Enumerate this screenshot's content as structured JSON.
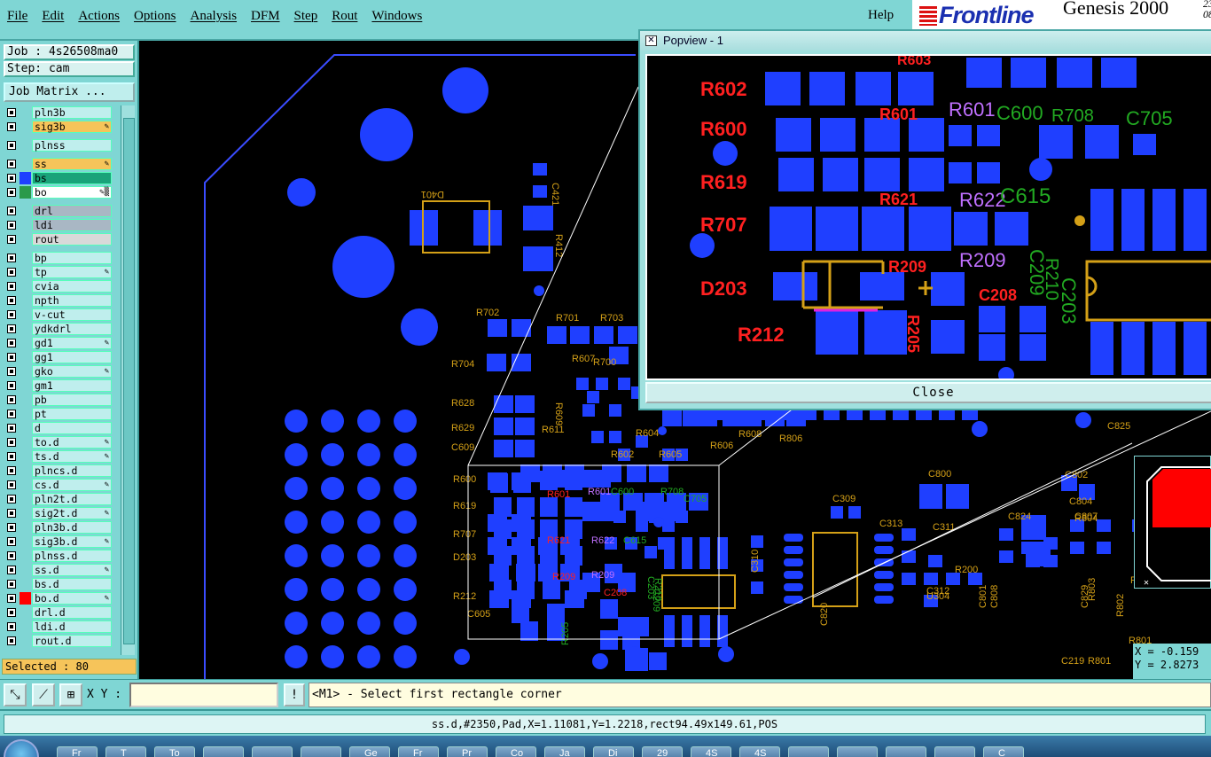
{
  "menu": {
    "items": [
      "File",
      "Edit",
      "Actions",
      "Options",
      "Analysis",
      "DFM",
      "Step",
      "Rout",
      "Windows"
    ],
    "help": "Help"
  },
  "brand": {
    "logo": "Frontline",
    "product": "Genesis 2000",
    "clock_top": "23",
    "clock_bottom": "08"
  },
  "job": {
    "job_line": "Job : 4s26508ma0",
    "step_line": "Step: cam",
    "job_matrix": "Job Matrix ..."
  },
  "layers": [
    {
      "name": "pln3b",
      "bg": "#bfeeed",
      "sq": "",
      "mark": ""
    },
    {
      "name": "sig3b",
      "bg": "#f6c45a",
      "sq": "",
      "mark": "✎"
    },
    {
      "name": "plnss",
      "bg": "#bfeeed",
      "sq": "",
      "mark": ""
    },
    {
      "name": "ss",
      "bg": "#f6c45a",
      "sq": "",
      "mark": "✎"
    },
    {
      "name": "bs",
      "bg": "#1aa37a",
      "sq": "#1f3fff",
      "mark": ""
    },
    {
      "name": "bo",
      "bg": "#ffffff",
      "sq": "#2a9a4a",
      "mark": "✎▒"
    },
    {
      "name": "drl",
      "bg": "#a9b7c4",
      "sq": "",
      "mark": ""
    },
    {
      "name": "ldi",
      "bg": "#a9b7c4",
      "sq": "",
      "mark": ""
    },
    {
      "name": "rout",
      "bg": "#d9d9d9",
      "sq": "",
      "mark": ""
    },
    {
      "name": "bp",
      "bg": "#bfeeed",
      "sq": "",
      "mark": ""
    },
    {
      "name": "tp",
      "bg": "#bfeeed",
      "sq": "",
      "mark": "✎"
    },
    {
      "name": "cvia",
      "bg": "#bfeeed",
      "sq": "",
      "mark": ""
    },
    {
      "name": "npth",
      "bg": "#bfeeed",
      "sq": "",
      "mark": ""
    },
    {
      "name": "v-cut",
      "bg": "#bfeeed",
      "sq": "",
      "mark": ""
    },
    {
      "name": "ydkdrl",
      "bg": "#bfeeed",
      "sq": "",
      "mark": ""
    },
    {
      "name": "gd1",
      "bg": "#bfeeed",
      "sq": "",
      "mark": "✎"
    },
    {
      "name": "gg1",
      "bg": "#bfeeed",
      "sq": "",
      "mark": ""
    },
    {
      "name": "gko",
      "bg": "#bfeeed",
      "sq": "",
      "mark": "✎"
    },
    {
      "name": "gm1",
      "bg": "#bfeeed",
      "sq": "",
      "mark": ""
    },
    {
      "name": "pb",
      "bg": "#bfeeed",
      "sq": "",
      "mark": ""
    },
    {
      "name": "pt",
      "bg": "#bfeeed",
      "sq": "",
      "mark": ""
    },
    {
      "name": "d",
      "bg": "#bfeeed",
      "sq": "",
      "mark": ""
    },
    {
      "name": "to.d",
      "bg": "#bfeeed",
      "sq": "",
      "mark": "✎"
    },
    {
      "name": "ts.d",
      "bg": "#bfeeed",
      "sq": "",
      "mark": "✎"
    },
    {
      "name": "plncs.d",
      "bg": "#bfeeed",
      "sq": "",
      "mark": ""
    },
    {
      "name": "cs.d",
      "bg": "#bfeeed",
      "sq": "",
      "mark": "✎"
    },
    {
      "name": "pln2t.d",
      "bg": "#bfeeed",
      "sq": "",
      "mark": ""
    },
    {
      "name": "sig2t.d",
      "bg": "#bfeeed",
      "sq": "",
      "mark": "✎"
    },
    {
      "name": "pln3b.d",
      "bg": "#bfeeed",
      "sq": "",
      "mark": ""
    },
    {
      "name": "sig3b.d",
      "bg": "#bfeeed",
      "sq": "",
      "mark": "✎"
    },
    {
      "name": "plnss.d",
      "bg": "#bfeeed",
      "sq": "",
      "mark": ""
    },
    {
      "name": "ss.d",
      "bg": "#bfeeed",
      "sq": "",
      "mark": "✎"
    },
    {
      "name": "bs.d",
      "bg": "#bfeeed",
      "sq": "",
      "mark": ""
    },
    {
      "name": "bo.d",
      "bg": "#bfeeed",
      "sq": "#ff0000",
      "mark": "✎"
    },
    {
      "name": "drl.d",
      "bg": "#bfeeed",
      "sq": "",
      "mark": ""
    },
    {
      "name": "ldi.d",
      "bg": "#bfeeed",
      "sq": "",
      "mark": ""
    },
    {
      "name": "rout.d",
      "bg": "#bfeeed",
      "sq": "",
      "mark": ""
    }
  ],
  "selected": "Selected : 80",
  "popview": {
    "title": "Popview - 1",
    "close": "Close",
    "labels_red": [
      "R602",
      "R600",
      "R619",
      "R707",
      "D203",
      "R212",
      "R601",
      "R621",
      "R209",
      "C208",
      "R603",
      "R205"
    ],
    "labels_purple": [
      "R601",
      "R622",
      "R209"
    ],
    "labels_green": [
      "C600",
      "R708",
      "C705",
      "C615",
      "R210",
      "C209",
      "C203"
    ]
  },
  "board": {
    "labels_orange": [
      "D401",
      "C421",
      "R412",
      "R702",
      "R701",
      "R703",
      "R700",
      "R704",
      "R607",
      "R628",
      "R629",
      "C609",
      "R609",
      "R611",
      "R604",
      "R605",
      "R602",
      "R600",
      "R619",
      "R707",
      "D203",
      "R212",
      "C605",
      "R606",
      "R608",
      "R806",
      "C800",
      "C802",
      "C804",
      "R804",
      "C807",
      "C311",
      "C309",
      "C313",
      "C310",
      "C312",
      "U304",
      "C820",
      "R200",
      "C219",
      "R801",
      "R801",
      "C829",
      "C808",
      "C801",
      "C824",
      "C825",
      "C808",
      "R802",
      "R800",
      "R803"
    ],
    "labels_red": [
      "R601",
      "R621",
      "R209",
      "C208"
    ],
    "labels_purple": [
      "R601",
      "R622",
      "R209"
    ],
    "labels_green": [
      "C600",
      "R708",
      "C705",
      "C615",
      "R210",
      "C209",
      "C203",
      "R205"
    ]
  },
  "coords": {
    "x": "X = -0.159",
    "y": "Y = 2.8273"
  },
  "toolbar": {
    "xy_label": "X Y :",
    "xy_value": "",
    "excl": "!",
    "prompt": "<M1> - Select first rectangle corner"
  },
  "status": "ss.d,#2350,Pad,X=1.11081,Y=1.2218,rect94.49x149.61,POS",
  "colors": {
    "pad": "#1f3fff",
    "silk_orange": "#d4a017",
    "silk_red": "#ff2020",
    "silk_green": "#22aa22",
    "silk_purple": "#c070ff",
    "outline": "#3a4cff",
    "panel": "#7fd6d4"
  },
  "taskbar": {
    "items": [
      "Fr",
      "T",
      "To",
      "",
      "",
      "",
      "Ge",
      "Fr",
      "Pr",
      "Co",
      "Ja",
      "Di",
      "29",
      "4S",
      "4S",
      "",
      "",
      "",
      "",
      "C"
    ]
  }
}
